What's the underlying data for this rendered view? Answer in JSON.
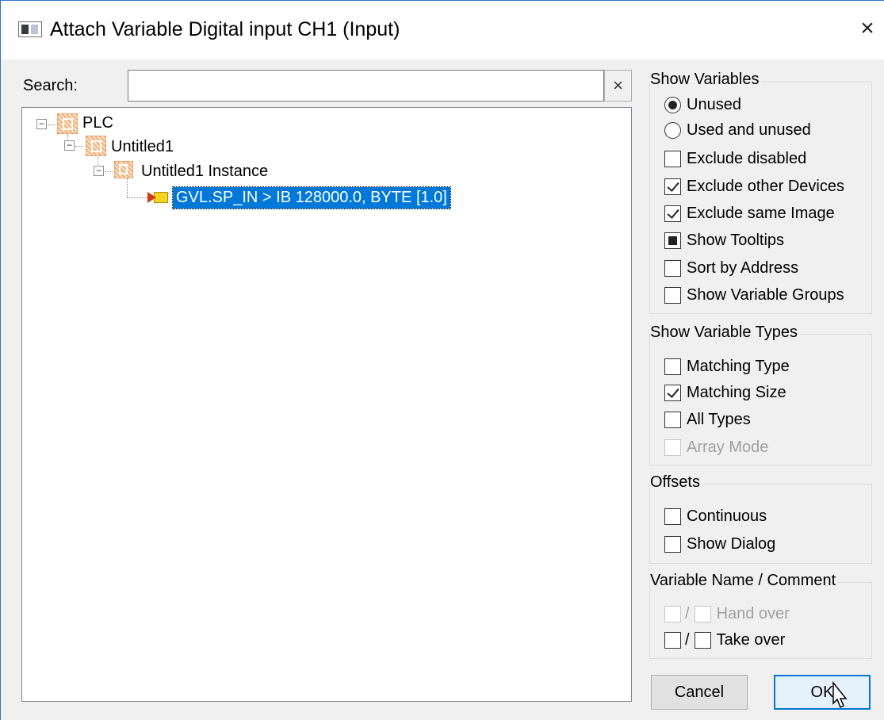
{
  "window": {
    "title": "Attach Variable Digital input CH1 (Input)",
    "close_glyph": "×"
  },
  "search": {
    "label": "Search:",
    "value": "",
    "clear_glyph": "×"
  },
  "tree": {
    "nodes": [
      {
        "label": "PLC",
        "icon": "plc-project-icon",
        "expanded": true
      },
      {
        "label": "Untitled1",
        "icon": "plc-project-icon",
        "expanded": true
      },
      {
        "label": "Untitled1 Instance",
        "icon": "plc-instance-icon",
        "expanded": true
      },
      {
        "label": "GVL.SP_IN    >    IB 128000.0, BYTE [1.0]",
        "icon": "input-variable-icon",
        "selected": true
      }
    ]
  },
  "show_variables": {
    "title": "Show Variables",
    "unused": "Unused",
    "used_and_unused": "Used and unused",
    "exclude_disabled": "Exclude disabled",
    "exclude_other_devices": "Exclude other Devices",
    "exclude_same_image": "Exclude same Image",
    "show_tooltips": "Show Tooltips",
    "sort_by_address": "Sort by Address",
    "show_variable_groups": "Show Variable Groups"
  },
  "show_variable_types": {
    "title": "Show Variable Types",
    "matching_type": "Matching Type",
    "matching_size": "Matching Size",
    "all_types": "All Types",
    "array_mode": "Array Mode"
  },
  "offsets": {
    "title": "Offsets",
    "continuous": "Continuous",
    "show_dialog": "Show Dialog"
  },
  "variable_name_comment": {
    "title": "Variable Name / Comment",
    "separator": "/",
    "hand_over": "Hand over",
    "take_over": "Take over"
  },
  "buttons": {
    "cancel": "Cancel",
    "ok": "OK"
  },
  "colors": {
    "selection": "#0078d7",
    "window_border": "#2b77c8",
    "dialog_bg": "#f0f0f0"
  }
}
